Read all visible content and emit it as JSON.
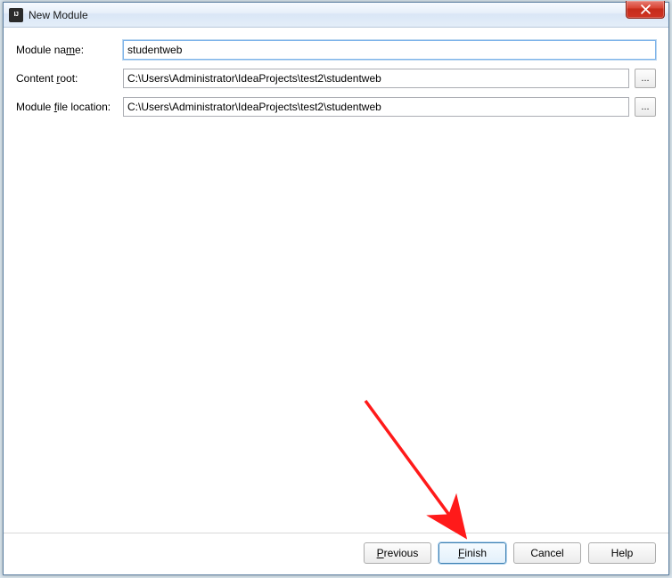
{
  "window": {
    "title": "New Module"
  },
  "form": {
    "moduleName": {
      "label_pre": "Module na",
      "label_ul": "m",
      "label_post": "e:",
      "value": "studentweb"
    },
    "contentRoot": {
      "label_pre": "Content ",
      "label_ul": "r",
      "label_post": "oot:",
      "value": "C:\\Users\\Administrator\\IdeaProjects\\test2\\studentweb"
    },
    "moduleFileLocation": {
      "label_pre": "Module ",
      "label_ul": "f",
      "label_post": "ile location:",
      "value": "C:\\Users\\Administrator\\IdeaProjects\\test2\\studentweb"
    },
    "browse_label": "..."
  },
  "buttons": {
    "previous_ul": "P",
    "previous_rest": "revious",
    "finish_ul": "F",
    "finish_rest": "inish",
    "cancel": "Cancel",
    "help": "Help"
  },
  "annotation": {
    "arrow_color": "#ff1a1a"
  }
}
